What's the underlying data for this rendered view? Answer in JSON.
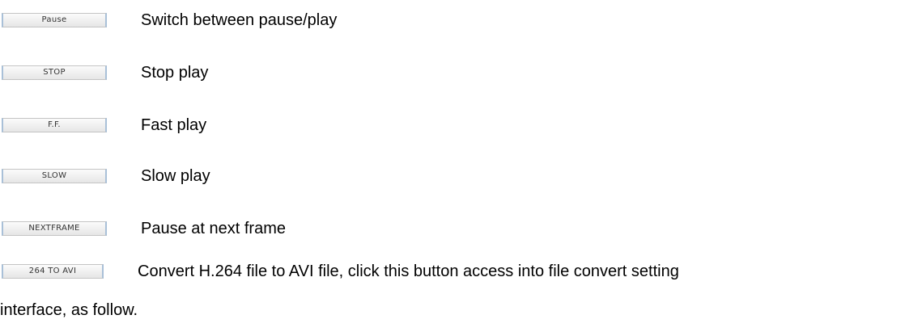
{
  "buttons": [
    {
      "label": "Pause",
      "description": "Switch between pause/play"
    },
    {
      "label": "STOP",
      "description": "Stop play"
    },
    {
      "label": "F.F.",
      "description": "Fast play"
    },
    {
      "label": "SLOW",
      "description": "Slow play"
    },
    {
      "label": "NEXTFRAME",
      "description": "Pause at next frame"
    },
    {
      "label": "264 TO AVI",
      "description": "Convert H.264 file to AVI file, click this button access into file convert setting"
    }
  ],
  "continuation": "interface, as follow."
}
